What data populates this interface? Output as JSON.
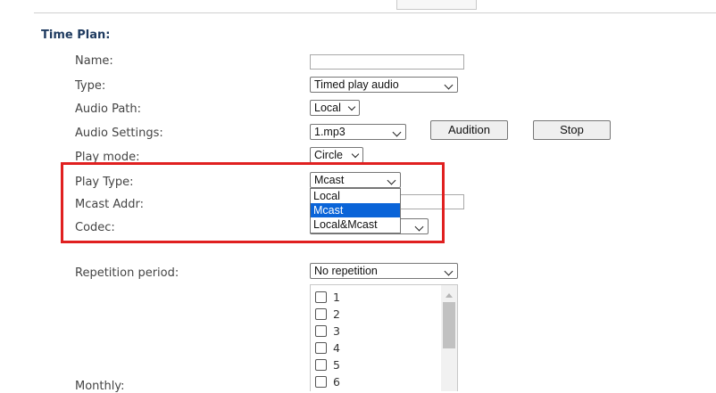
{
  "section": {
    "title": "Time Plan:"
  },
  "fields": {
    "name": {
      "label": "Name:",
      "value": ""
    },
    "type": {
      "label": "Type:",
      "value": "Timed play audio"
    },
    "audio_path": {
      "label": "Audio Path:",
      "value": "Local"
    },
    "audio_settings": {
      "label": "Audio Settings:",
      "value": "1.mp3",
      "audition_label": "Audition",
      "stop_label": "Stop"
    },
    "play_mode": {
      "label": "Play mode:",
      "value": "Circle"
    },
    "play_type": {
      "label": "Play Type:",
      "value": "Mcast",
      "options": [
        "Local",
        "Mcast",
        "Local&Mcast"
      ],
      "highlighted_option": "Mcast"
    },
    "mcast_addr": {
      "label": "Mcast Addr:",
      "value": ""
    },
    "codec": {
      "label": "Codec:",
      "value": ""
    },
    "repetition_period": {
      "label": "Repetition period:",
      "value": "No repetition"
    },
    "monthly": {
      "label": "Monthly:",
      "days": [
        "1",
        "2",
        "3",
        "4",
        "5",
        "6"
      ]
    }
  },
  "colors": {
    "highlight_border": "#e02020",
    "option_selected": "#0a64d8",
    "section_title": "#1e3a5f"
  },
  "icons": {
    "dropdown": "chevron-down-icon",
    "scroll_up": "scroll-up-arrow-icon"
  }
}
